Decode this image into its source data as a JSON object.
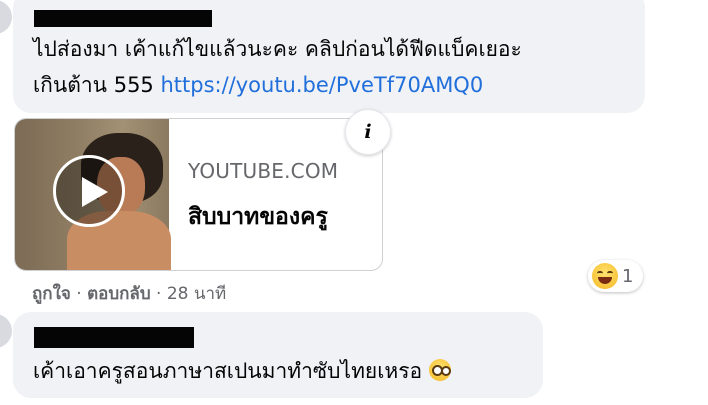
{
  "comments": [
    {
      "text_line1": "ไปส่องมา เค้าแก้ไขแล้วนะคะ คลิปก่อนได้ฟีดแบ็คเยอะ",
      "text_line2_prefix": "เกินต้าน 555 ",
      "link": "https://youtu.be/PveTf70AMQ0"
    },
    {
      "text": "เค้าเอาครูสอนภาษาสเปนมาทำซับไทยเหรอ"
    }
  ],
  "link_preview": {
    "domain": "YOUTUBE.COM",
    "title": "สิบบาทของครู",
    "info_label": "i"
  },
  "actions": {
    "like": "ถูกใจ",
    "separator1": " · ",
    "reply": "ตอบกลับ",
    "separator2": " · ",
    "time": "28 นาที"
  },
  "reaction": {
    "count": "1"
  },
  "colors": {
    "bubble": "#f0f2f5",
    "link": "#216fdb",
    "meta": "#65676b"
  }
}
